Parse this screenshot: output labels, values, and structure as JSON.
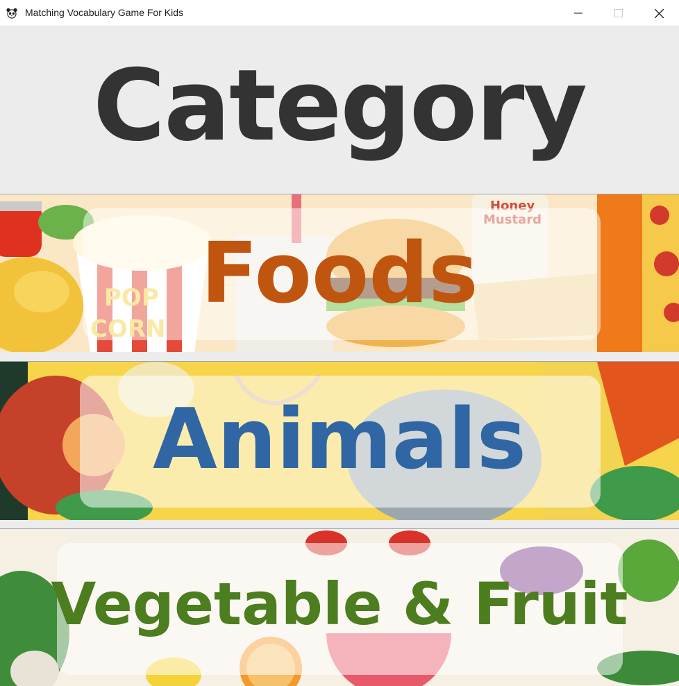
{
  "window": {
    "title": "Matching Vocabulary Game For Kids",
    "icons": {
      "app": "panda-app-icon",
      "minimize": "minimize-icon",
      "maximize": "maximize-icon",
      "close": "close-icon"
    }
  },
  "header": {
    "title": "Category"
  },
  "categories": [
    {
      "label": "Foods",
      "color": "#c0550f",
      "theme": "fast food"
    },
    {
      "label": "Animals",
      "color": "#2f66a3",
      "theme": "animals"
    },
    {
      "label": "Vegetable & Fruit",
      "color": "#4c7d1e",
      "theme": "vegetables and fruits"
    }
  ],
  "colors": {
    "header_bg": "#ececec",
    "title_text": "#333333",
    "panel_border": "#9aa6b0"
  }
}
